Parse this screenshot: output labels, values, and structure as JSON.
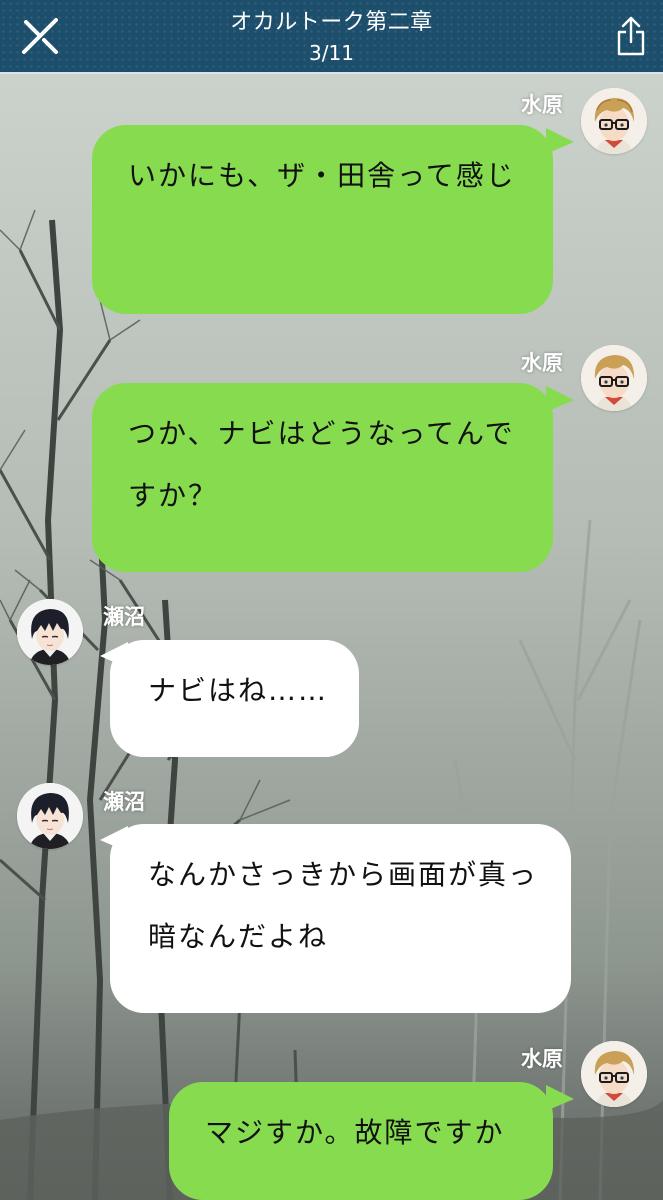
{
  "header": {
    "title": "オカルトーク第二章",
    "progress": "3/11",
    "color": "#1d4f6c"
  },
  "icons": {
    "close": "close-icon",
    "share": "share-icon"
  },
  "colors": {
    "sent_bubble": "#86dc4e",
    "received_bubble": "#ffffff"
  },
  "messages": [
    {
      "sender": "水原",
      "side": "right",
      "text": "いかにも、ザ・田舎って感じ"
    },
    {
      "sender": "水原",
      "side": "right",
      "text": "つか、ナビはどうなってんですか？"
    },
    {
      "sender": "瀬沼",
      "side": "left",
      "text": "ナビはね……"
    },
    {
      "sender": "瀬沼",
      "side": "left",
      "text": "なんかさっきから画面が真っ暗なんだよね"
    },
    {
      "sender": "水原",
      "side": "right",
      "text": "マジすか。故障ですか"
    }
  ]
}
